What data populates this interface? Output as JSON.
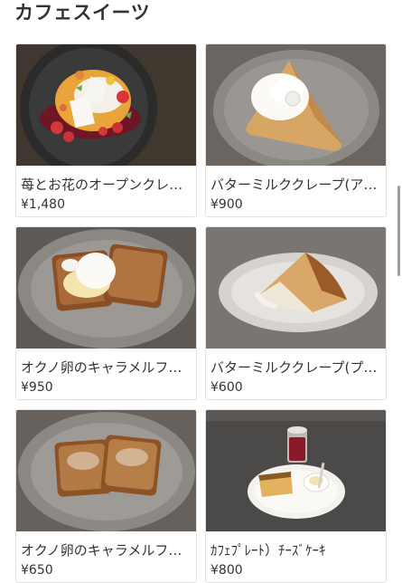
{
  "section": {
    "title": "カフェスイーツ"
  },
  "items": [
    {
      "name": "苺とお花のオープンクレ…",
      "price": "¥1,480",
      "photo": "strawberry-flower-crepe-photo"
    },
    {
      "name": "バターミルククレープ(ア…",
      "price": "¥900",
      "photo": "buttermilk-crepe-cream-photo"
    },
    {
      "name": "オクノ卵のキャラメルフ…",
      "price": "¥950",
      "photo": "caramel-french-toast-cream-photo"
    },
    {
      "name": "バターミルククレープ(プ…",
      "price": "¥600",
      "photo": "buttermilk-crepe-plain-photo"
    },
    {
      "name": "オクノ卵のキャラメルフ…",
      "price": "¥650",
      "photo": "caramel-french-toast-photo"
    },
    {
      "name": "ｶﾌｪﾌﾟﾚｰﾄ）ﾁｰｽﾞｹｰｷ",
      "price": "¥800",
      "photo": "cafe-plate-cheesecake-photo"
    }
  ]
}
